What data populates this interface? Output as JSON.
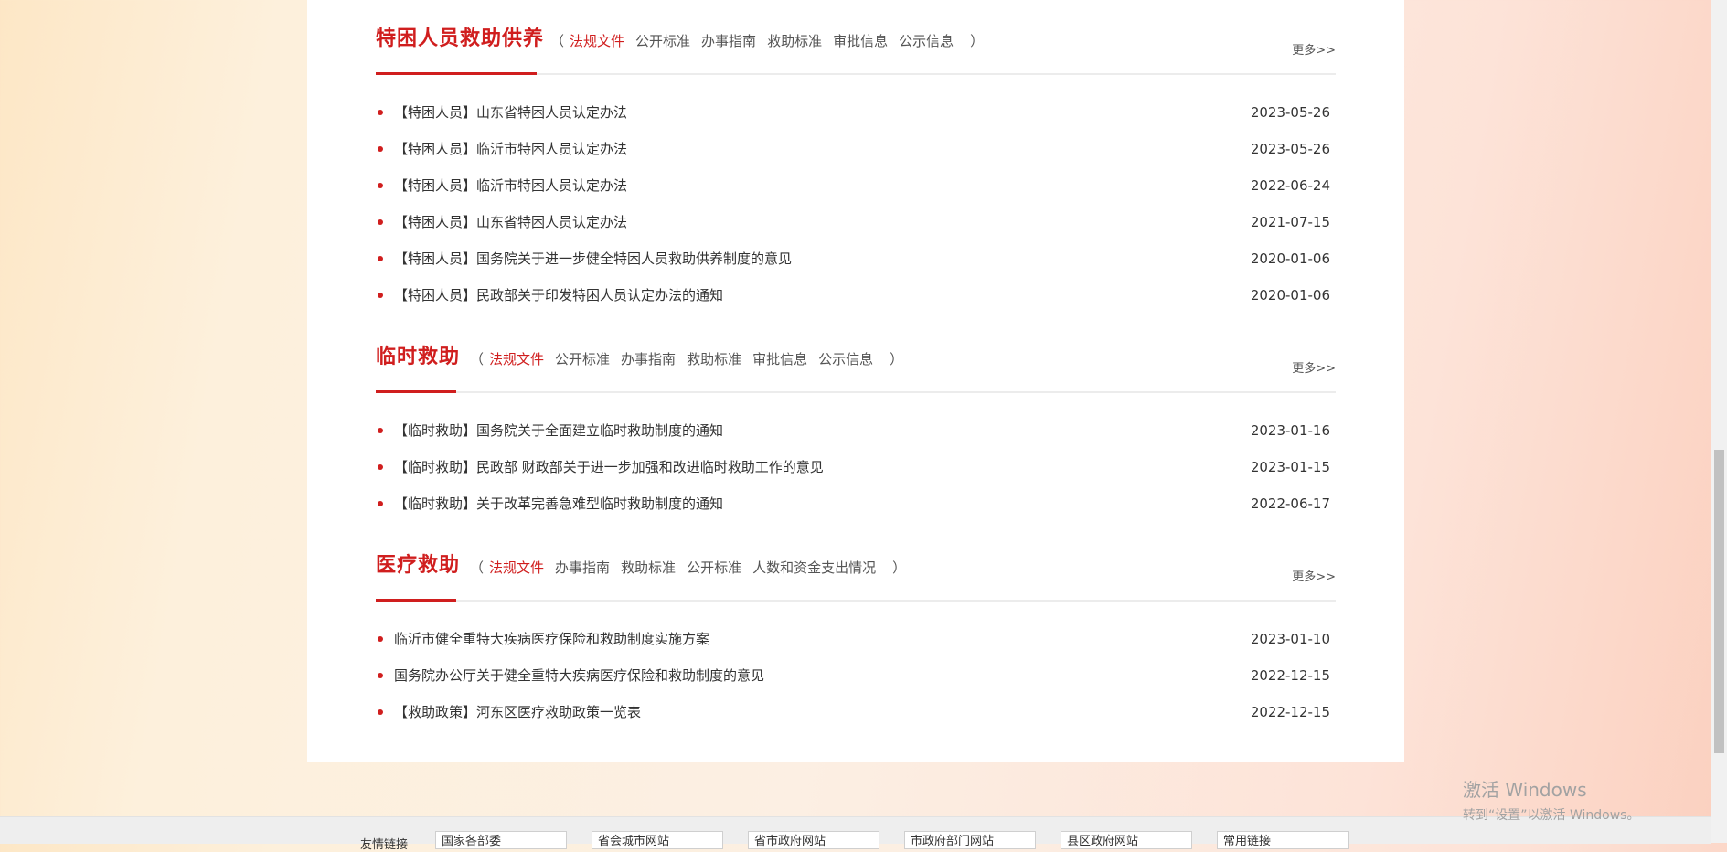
{
  "sections": [
    {
      "title": "特困人员救助供养",
      "tabs": [
        "法规文件",
        "公开标准",
        "办事指南",
        "救助标准",
        "审批信息",
        "公示信息"
      ],
      "more": "更多>>",
      "items": [
        {
          "title": "【特困人员】山东省特困人员认定办法",
          "date": "2023-05-26"
        },
        {
          "title": "【特困人员】临沂市特困人员认定办法",
          "date": "2023-05-26"
        },
        {
          "title": "【特困人员】临沂市特困人员认定办法",
          "date": "2022-06-24"
        },
        {
          "title": "【特困人员】山东省特困人员认定办法",
          "date": "2021-07-15"
        },
        {
          "title": "【特困人员】国务院关于进一步健全特困人员救助供养制度的意见",
          "date": "2020-01-06"
        },
        {
          "title": "【特困人员】民政部关于印发特困人员认定办法的通知",
          "date": "2020-01-06"
        }
      ]
    },
    {
      "title": "临时救助",
      "tabs": [
        "法规文件",
        "公开标准",
        "办事指南",
        "救助标准",
        "审批信息",
        "公示信息"
      ],
      "more": "更多>>",
      "items": [
        {
          "title": "【临时救助】国务院关于全面建立临时救助制度的通知",
          "date": "2023-01-16"
        },
        {
          "title": "【临时救助】民政部 财政部关于进一步加强和改进临时救助工作的意见",
          "date": "2023-01-15"
        },
        {
          "title": "【临时救助】关于改革完善急难型临时救助制度的通知",
          "date": "2022-06-17"
        }
      ]
    },
    {
      "title": "医疗救助",
      "tabs": [
        "法规文件",
        "办事指南",
        "救助标准",
        "公开标准",
        "人数和资金支出情况"
      ],
      "more": "更多>>",
      "items": [
        {
          "title": "临沂市健全重特大疾病医疗保险和救助制度实施方案",
          "date": "2023-01-10"
        },
        {
          "title": "国务院办公厅关于健全重特大疾病医疗保险和救助制度的意见",
          "date": "2022-12-15"
        },
        {
          "title": "【救助政策】河东区医疗救助政策一览表",
          "date": "2022-12-15"
        }
      ]
    }
  ],
  "footer": {
    "label": "友情链接",
    "selects": [
      "国家各部委",
      "省会城市网站",
      "省市政府网站",
      "市政府部门网站",
      "县区政府网站",
      "常用链接"
    ]
  },
  "watermark": {
    "line1": "激活 Windows",
    "line2": "转到“设置”以激活 Windows。"
  },
  "colors": {
    "accent": "#d01e1e"
  },
  "open_paren": "（",
  "close_paren": "）"
}
